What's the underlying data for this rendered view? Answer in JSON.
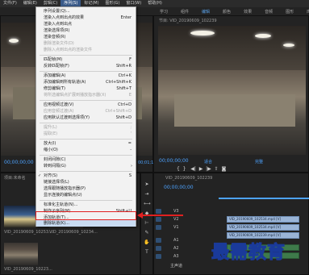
{
  "menubar": {
    "items": [
      "文件(F)",
      "编辑(E)",
      "剪辑(C)",
      "序列(S)",
      "标记(M)",
      "图形(G)",
      "窗口(W)",
      "帮助(H)"
    ],
    "active_index": 3
  },
  "workspace": {
    "items": [
      "学习",
      "组件",
      "编辑",
      "颜色",
      "效果",
      "音频",
      "图形",
      "库"
    ],
    "active_index": 2
  },
  "source_panel": {
    "timecode": "00;00;00;00",
    "timecode_right": "00;01;14"
  },
  "program_panel": {
    "tab_label": "节目: VID_20190609_102239",
    "timecode": "00;00;00;00",
    "fit_label": "适合",
    "page_label": "完整"
  },
  "project_panel": {
    "tab_label": "项目:未命名",
    "clips": [
      {
        "label": "VID_20190609_10253..."
      },
      {
        "label": "VID_20190609_10234..."
      },
      {
        "label": "VID_20190609_10223..."
      }
    ]
  },
  "timeline": {
    "tab_label": "VID_20190609_102239",
    "timecode": "00;00;00;00",
    "video_tracks": [
      "V3",
      "V2",
      "V1"
    ],
    "audio_tracks": [
      "A1",
      "A2",
      "A3"
    ],
    "master_label": "主声道",
    "clips": [
      {
        "label": "VID_20190609_102534.mp4 [V]"
      },
      {
        "label": "VID_20190609_102534.mp4 [V]"
      },
      {
        "label": "VID_20190609_102239.mp4 [V]"
      }
    ]
  },
  "menu": {
    "items": [
      {
        "label": "序列设置(Q)...",
        "shortcut": "",
        "disabled": false
      },
      {
        "label": "渲染入点到出点的效果",
        "shortcut": "Enter",
        "disabled": false
      },
      {
        "label": "渲染入点到出点",
        "shortcut": "",
        "disabled": false
      },
      {
        "label": "渲染选择项(R)",
        "shortcut": "",
        "disabled": false
      },
      {
        "label": "渲染音频(R)",
        "shortcut": "",
        "disabled": false
      },
      {
        "label": "删除渲染文件(D)",
        "shortcut": "",
        "disabled": true
      },
      {
        "label": "删除入点到出点的渲染文件",
        "shortcut": "",
        "disabled": true
      },
      {
        "label": "匹配帧(M)",
        "shortcut": "F",
        "disabled": false
      },
      {
        "label": "反转匹配帧(F)",
        "shortcut": "Shift+R",
        "disabled": false
      },
      {
        "label": "添加编辑(A)",
        "shortcut": "Ctrl+K",
        "disabled": false
      },
      {
        "label": "添加编辑到所有轨道(A)",
        "shortcut": "Ctrl+Shift+K",
        "disabled": false
      },
      {
        "label": "修剪编辑(T)",
        "shortcut": "Shift+T",
        "disabled": false
      },
      {
        "label": "将所选编辑点扩展到播放指示器(X)",
        "shortcut": "E",
        "disabled": true
      },
      {
        "label": "应用视频过渡(V)",
        "shortcut": "Ctrl+D",
        "disabled": false
      },
      {
        "label": "应用音频过渡(A)",
        "shortcut": "Ctrl+Shift+D",
        "disabled": true
      },
      {
        "label": "应用默认过渡到选择项(Y)",
        "shortcut": "Shift+D",
        "disabled": false
      },
      {
        "label": "提升(L)",
        "shortcut": ";",
        "disabled": true
      },
      {
        "label": "提取(E)",
        "shortcut": "'",
        "disabled": true
      },
      {
        "label": "放大(I)",
        "shortcut": "=",
        "disabled": false
      },
      {
        "label": "缩小(O)",
        "shortcut": "-",
        "disabled": false
      },
      {
        "label": "封闭间隙(C)",
        "shortcut": "",
        "disabled": false
      },
      {
        "label": "转到间隔(G)",
        "shortcut": "",
        "disabled": false,
        "submenu": true
      },
      {
        "label": "对齐(S)",
        "shortcut": "S",
        "disabled": false,
        "checked": true
      },
      {
        "label": "链接选择项(L)",
        "shortcut": "",
        "disabled": false
      },
      {
        "label": "选择跟随播放指示器(P)",
        "shortcut": "",
        "disabled": false
      },
      {
        "label": "显示连接的编辑点(U)",
        "shortcut": "",
        "disabled": false
      },
      {
        "label": "标准化主轨道(N)...",
        "shortcut": "",
        "disabled": false
      },
      {
        "label": "制作子序列(M)",
        "shortcut": "Shift+U",
        "disabled": false
      },
      {
        "label": "添加轨道(T)...",
        "shortcut": "",
        "disabled": false
      },
      {
        "label": "删除轨道(K)...",
        "shortcut": "",
        "disabled": false,
        "highlighted": true
      }
    ]
  },
  "watermark": "最需教育"
}
